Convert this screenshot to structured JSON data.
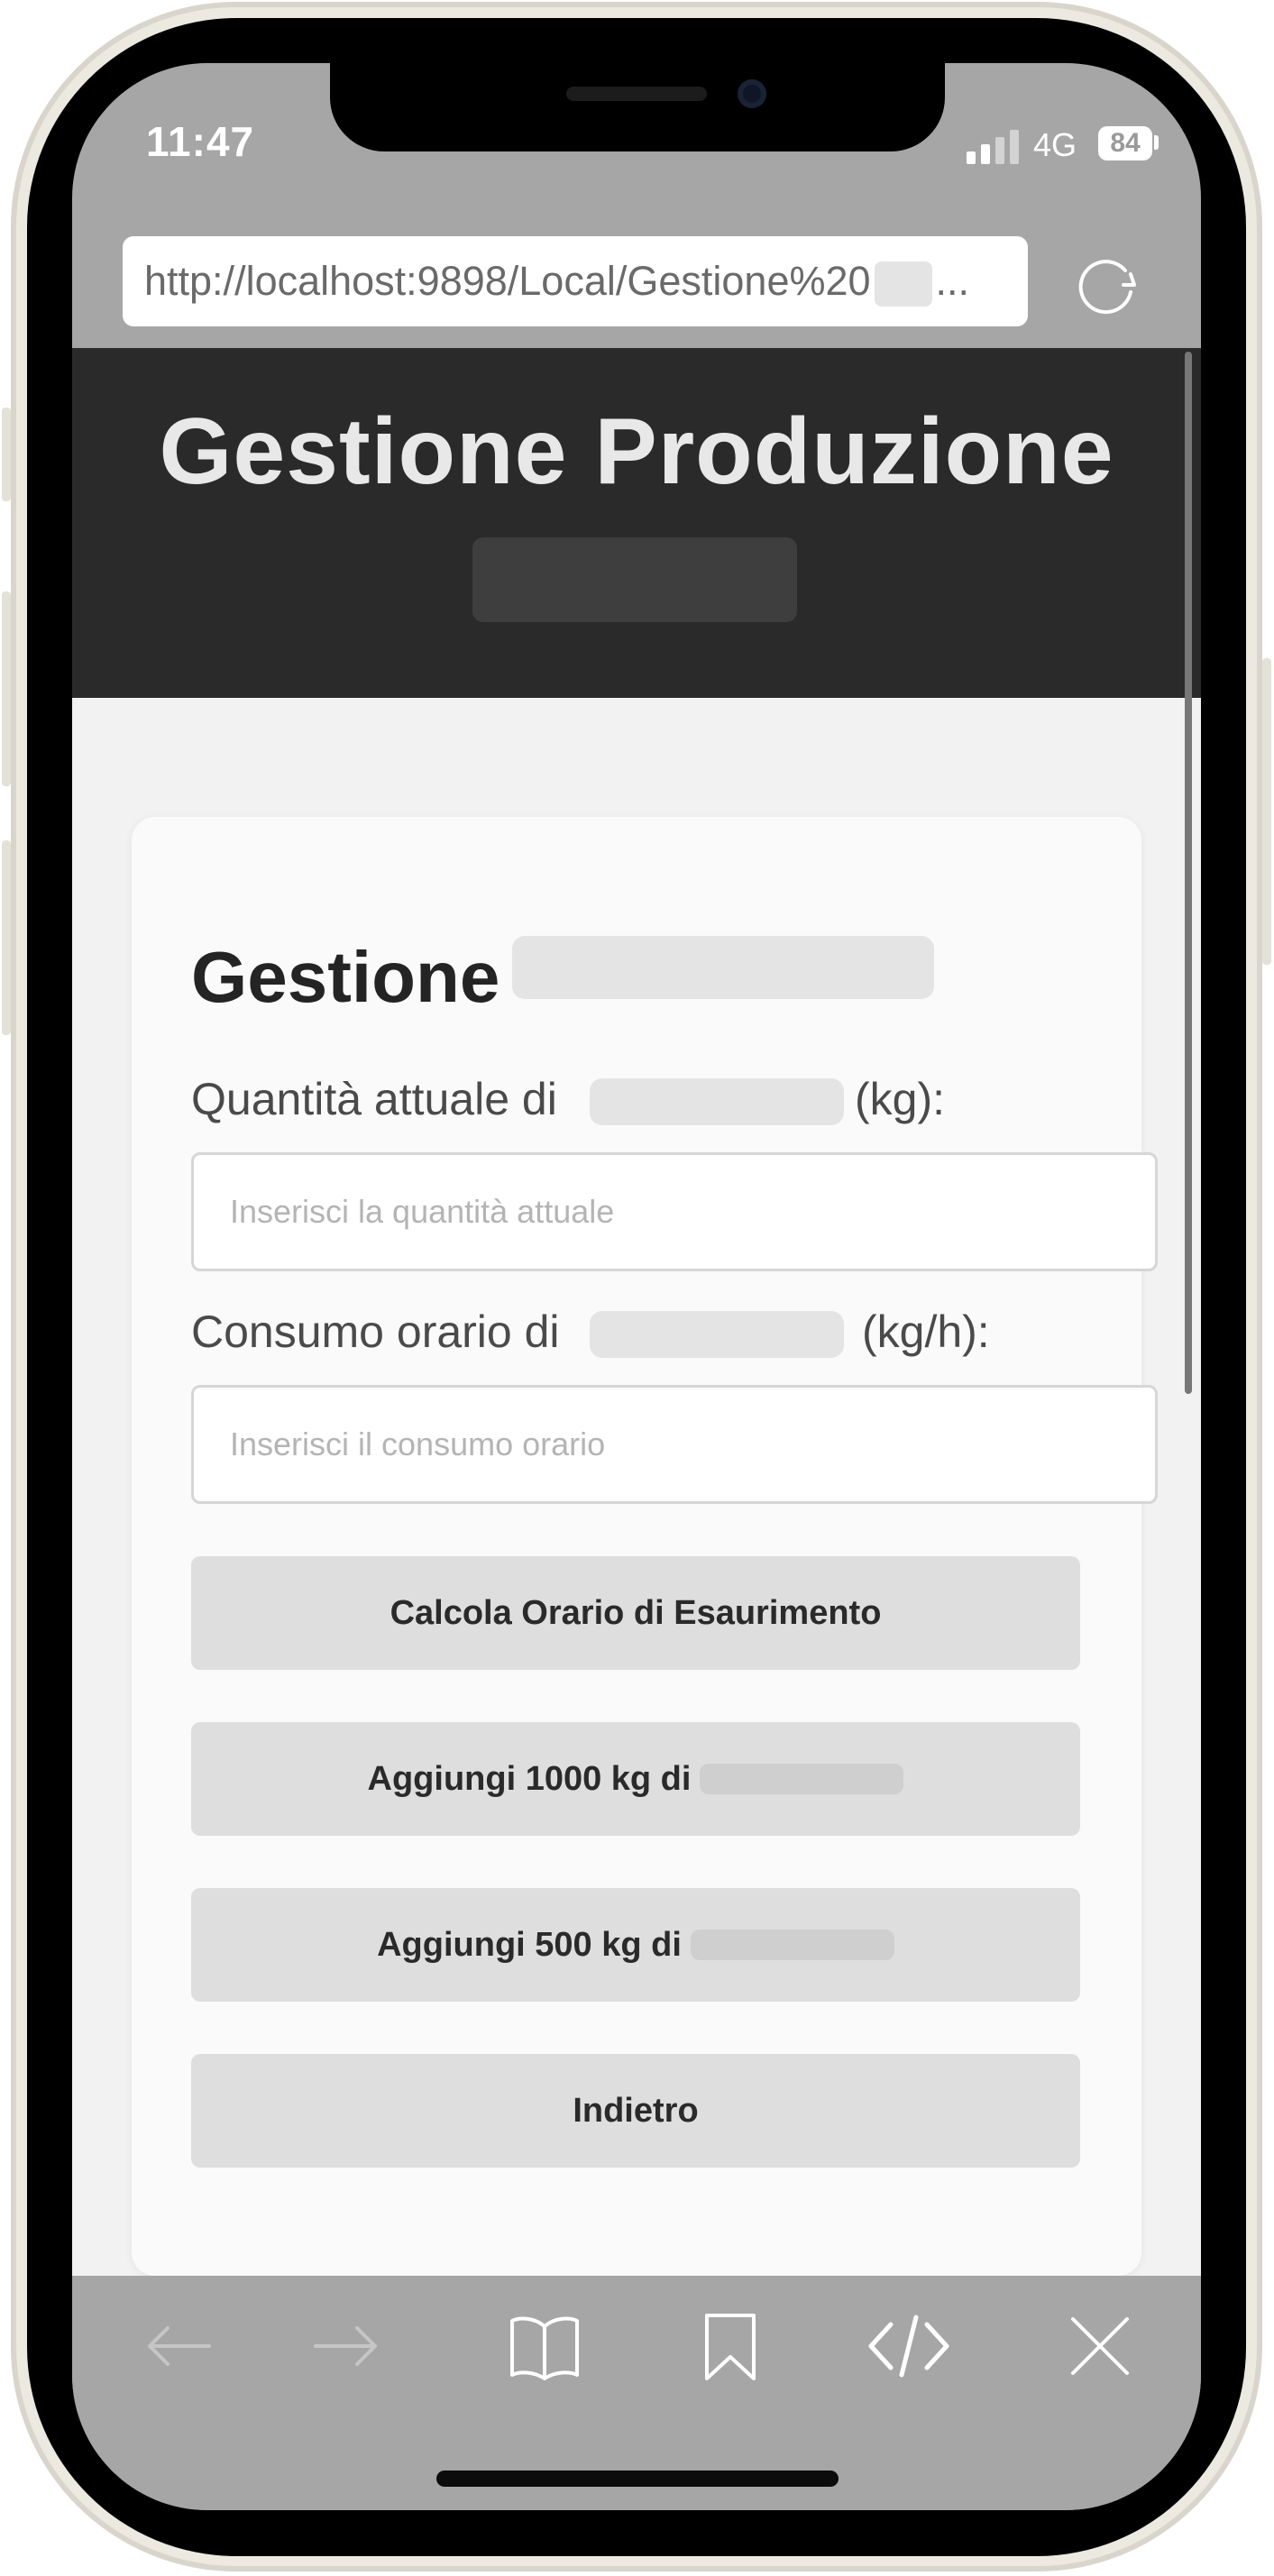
{
  "status_bar": {
    "time": "11:47",
    "network": "4G",
    "battery": "84"
  },
  "browser": {
    "url": "http://localhost:9898/Local/Gestione%20",
    "url_ellipsis": "...",
    "reload_icon": "reload-icon"
  },
  "header": {
    "title": "Gestione Produzione"
  },
  "form": {
    "title": "Gestione",
    "quantity_label_prefix": "Quantità attuale di",
    "quantity_label_suffix": "(kg):",
    "quantity_placeholder": "Inserisci la quantità attuale",
    "consumption_label_prefix": "Consumo orario di",
    "consumption_label_suffix": "(kg/h):",
    "consumption_placeholder": "Inserisci il consumo orario",
    "calc_button": "Calcola Orario di Esaurimento",
    "add1000_button": "Aggiungi 1000 kg di",
    "add500_button": "Aggiungi 500 kg di",
    "back_button": "Indietro"
  },
  "toolbar": {
    "icons": [
      "back-arrow-icon",
      "forward-arrow-icon",
      "book-icon",
      "bookmark-icon",
      "code-icon",
      "close-icon"
    ]
  },
  "colors": {
    "header_bg": "#2a2a2a",
    "button_bg": "#dedede",
    "toolbar_bg": "#a6a6a6"
  }
}
